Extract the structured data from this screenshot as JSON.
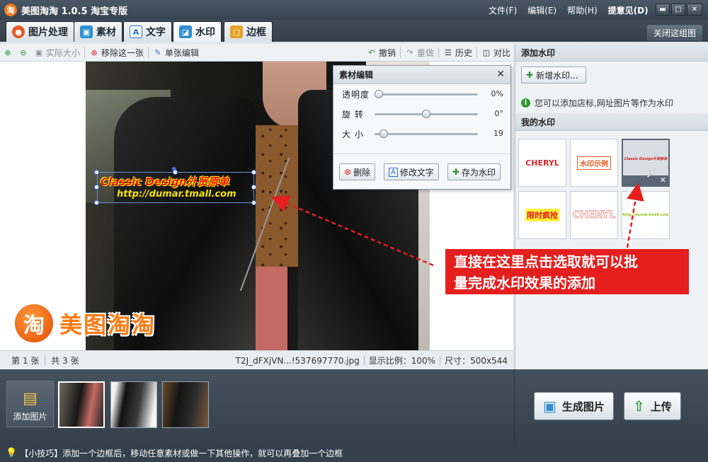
{
  "app": {
    "logo_char": "淘",
    "title": "美图淘淘 1.0.5 淘宝专版"
  },
  "menu": {
    "file": "文件(F)",
    "edit": "编辑(E)",
    "help": "帮助(H)",
    "feedback": "提意见(D)"
  },
  "window_controls": {
    "restore": "▭",
    "maximize": "□",
    "close": "✕"
  },
  "tabs": [
    {
      "label": "图片处理",
      "icon": "palette-icon",
      "color": "#e65b2a"
    },
    {
      "label": "素材",
      "icon": "material-icon",
      "color": "#2f8fd1"
    },
    {
      "label": "文字",
      "icon": "text-icon",
      "color": "#2f6fd1"
    },
    {
      "label": "水印",
      "icon": "watermark-icon",
      "color": "#2f8fd1",
      "active": true
    },
    {
      "label": "边框",
      "icon": "frame-icon",
      "color": "#e6a22a"
    }
  ],
  "close_group": "关闭这组图",
  "toolbar": {
    "actual_size": "实际大小",
    "remove_one": "移除这一张",
    "single_edit": "单张编辑",
    "undo": "撤销",
    "redo": "重做",
    "history": "历史",
    "compare": "对比"
  },
  "watermark_overlay": {
    "line1": "Classic Design外贸原单",
    "line2": "http://dumar.tmall.com"
  },
  "logo_watermark": {
    "char": "淘",
    "text": "美图淘淘"
  },
  "dialog": {
    "title": "素材编辑",
    "close": "✕",
    "sliders": [
      {
        "label": "透明度",
        "value_text": "0%",
        "value": 0
      },
      {
        "label": "旋 转",
        "value_text": "0°",
        "value": 0.5
      },
      {
        "label": "大 小",
        "value_text": "19",
        "value": 0.05
      }
    ],
    "buttons": {
      "delete": "删除",
      "edit_text": "修改文字",
      "save_wm": "存为水印"
    }
  },
  "status": {
    "page": "第 1 张",
    "total": "共 3 张",
    "filename": "T2J_dFXjVN...!537697770.jpg",
    "ratio": "显示比例：100%",
    "size": "尺寸：500x544"
  },
  "right_panel": {
    "add_title": "添加水印",
    "add_button": "新增水印...",
    "tip": "您可以添加店标,网址图片等作为水印",
    "my_title": "我的水印",
    "watermarks": [
      {
        "text": "CHERYL",
        "accent": "#d8262b"
      },
      {
        "text": "水印示例",
        "accent": "#e85a1c"
      },
      {
        "text": "Classic Design外贸原单",
        "accent": "#d32020",
        "selected": true
      },
      {
        "text": "限时疯抢",
        "accent": "#e21b1b"
      },
      {
        "text": "CHERYL",
        "accent": "#e7a0a0"
      },
      {
        "text": "http://dumar.tmall.com",
        "accent": "#9fbf1a"
      }
    ]
  },
  "callout": {
    "line1": "直接在这里点击选取就可以批",
    "line2": "量完成水印效果的添加"
  },
  "bottom": {
    "add_image": "添加图片",
    "generate": "生成图片",
    "upload": "上传"
  },
  "tipbar": {
    "text": "【小技巧】添加一个边框后，移动任意素材或做一下其他操作，就可以再叠加一个边框"
  },
  "colors": {
    "accent_red": "#e51e1e",
    "title_bar": "#37434f"
  }
}
